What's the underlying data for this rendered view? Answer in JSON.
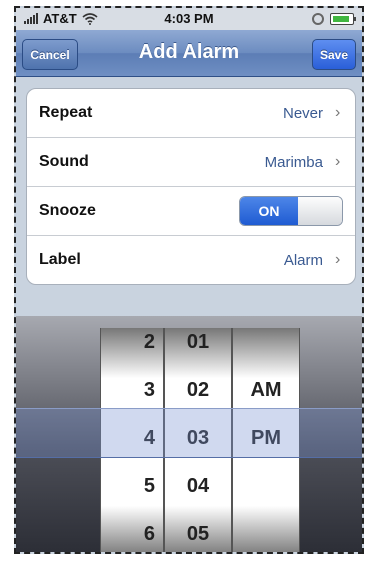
{
  "status": {
    "carrier": "AT&T",
    "time": "4:03 PM"
  },
  "nav": {
    "title": "Add Alarm",
    "cancel": "Cancel",
    "save": "Save"
  },
  "rows": [
    {
      "label": "Repeat",
      "value": "Never"
    },
    {
      "label": "Sound",
      "value": "Marimba"
    },
    {
      "label": "Snooze",
      "toggle": "ON"
    },
    {
      "label": "Label",
      "value": "Alarm"
    }
  ],
  "picker": {
    "hours": [
      "2",
      "3",
      "4",
      "5",
      "6"
    ],
    "minutes": [
      "01",
      "02",
      "03",
      "04",
      "05"
    ],
    "ampm": [
      "AM",
      "PM"
    ]
  },
  "icons": {
    "chevron": "›",
    "signal": "signal-bars-icon",
    "wifi": "wifi-icon",
    "battery": "battery-icon"
  }
}
